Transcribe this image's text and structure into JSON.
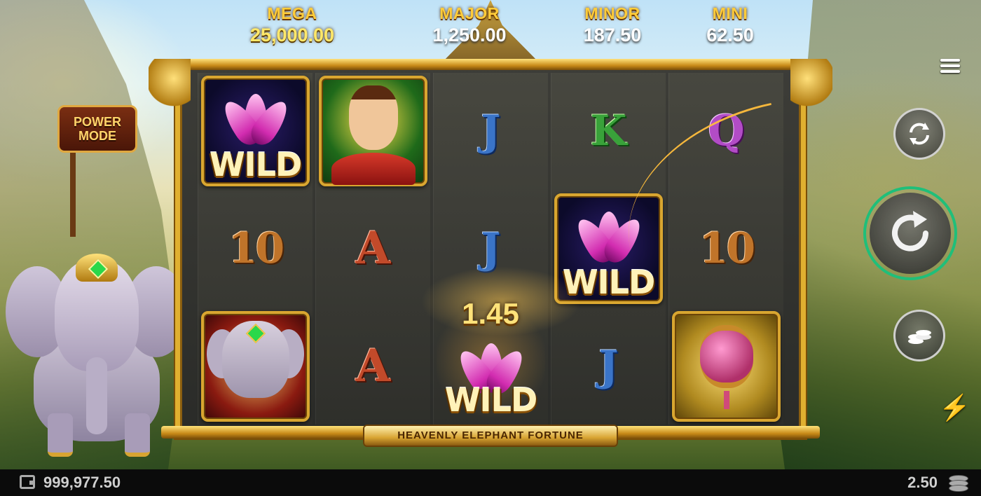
{
  "jackpots": {
    "mega": {
      "label": "MEGA",
      "value": "25,000.00"
    },
    "major": {
      "label": "MAJOR",
      "value": "1,250.00"
    },
    "minor": {
      "label": "MINOR",
      "value": "187.50"
    },
    "mini": {
      "label": "MINI",
      "value": "62.50"
    }
  },
  "power_mode": {
    "line1": "POWER",
    "line2": "MODE"
  },
  "game_title": "HEAVENLY ELEPHANT FORTUNE",
  "reels": [
    [
      {
        "symbol": "wild",
        "text": "WILD"
      },
      {
        "symbol": "10",
        "text": "10"
      },
      {
        "symbol": "elephant",
        "text": ""
      }
    ],
    [
      {
        "symbol": "princess",
        "text": ""
      },
      {
        "symbol": "A",
        "text": "A"
      },
      {
        "symbol": "A",
        "text": "A"
      }
    ],
    [
      {
        "symbol": "J",
        "text": "J"
      },
      {
        "symbol": "J",
        "text": "J"
      },
      {
        "symbol": "wild-open",
        "text": "WILD"
      }
    ],
    [
      {
        "symbol": "K",
        "text": "K"
      },
      {
        "symbol": "wild",
        "text": "WILD"
      },
      {
        "symbol": "J",
        "text": "J"
      }
    ],
    [
      {
        "symbol": "Q",
        "text": "Q"
      },
      {
        "symbol": "10",
        "text": "10"
      },
      {
        "symbol": "lantern",
        "text": ""
      }
    ]
  ],
  "win_amount": "1.45",
  "controls": {
    "menu_icon": "hamburger-icon",
    "autoplay_icon": "autoplay-icon",
    "spin_icon": "spin-icon",
    "bet_icon": "coins-icon",
    "turbo_icon": "lightning-icon",
    "turbo_glyph": "⚡"
  },
  "status_bar": {
    "balance": "999,977.50",
    "bet": "2.50"
  },
  "colors": {
    "frame_gold": "#e0b030",
    "spin_ring_green": "#1fbf7a",
    "spin_ring_blue": "#2a9ad8",
    "jackpot_label": "#ffcc3a"
  }
}
